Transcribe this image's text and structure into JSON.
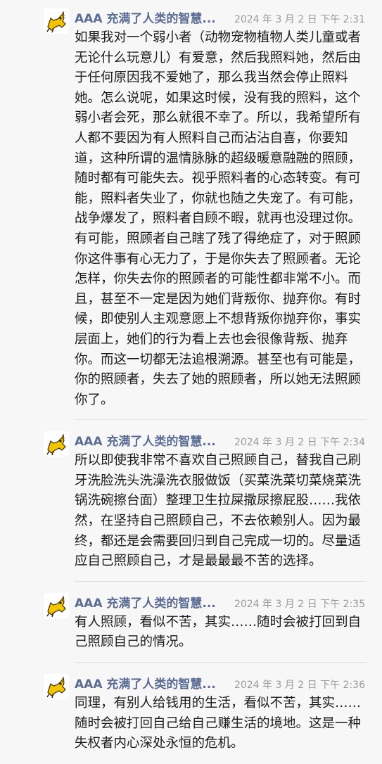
{
  "messages": [
    {
      "sender": "AAA 充满了人类的智慧...",
      "time": "2024 年 3 月 2 日 下午 2:31",
      "text": "如果我对一个弱小者（动物宠物植物人类儿童或者无论什么玩意儿）有爱意，然后我照料她，然后由于任何原因我不爱她了，那么我当然会停止照料她。怎么说呢，如果这时候，没有我的照料，这个弱小者会死，那么就很不幸了。所以，我希望所有人都不要因为有人照料自己而沾沾自喜，你要知道，这种所谓的温情脉脉的超级暖意融融的照顾，随时都有可能失去。视乎照料者的心态转变。有可能，照料者失业了，你就也随之失宠了。有可能，战争爆发了，照料者自顾不暇，就再也没理过你。有可能，照顾者自己瞎了残了得绝症了，对于照顾你这件事有心无力了，于是你失去了照顾者。无论怎样，你失去你的照顾者的可能性都非常不小。而且，甚至不一定是因为她们背叛你、抛弃你。有时候，即使别人主观意愿上不想背叛你抛弃你，事实层面上，她们的行为看上去也会很像背叛、抛弃你。而这一切都无法追根溯源。甚至也有可能是，你的照顾者，失去了她的照顾者，所以她无法照顾你了。"
    },
    {
      "sender": "AAA 充满了人类的智慧...",
      "time": "2024 年 3 月 2 日 下午 2:34",
      "text": "所以即使我非常不喜欢自己照顾自己，替我自己刷牙洗脸洗头洗澡洗衣服做饭（买菜洗菜切菜烧菜洗锅洗碗擦台面）整理卫生拉屎撒尿擦屁股……我依然，在坚持自己照顾自己，不去依赖别人。因为最终，都还是会需要回归到自己完成一切的。尽量适应自己照顾自己，才是最最最不苦的选择。"
    },
    {
      "sender": "AAA 充满了人类的智慧...",
      "time": "2024 年 3 月 2 日 下午 2:35",
      "text": "有人照顾，看似不苦，其实……随时会被打回到自己照顾自己的情况。"
    },
    {
      "sender": "AAA 充满了人类的智慧...",
      "time": "2024 年 3 月 2 日 下午 2:36",
      "text": "同理，有别人给钱用的生活，看似不苦，其实……随时会被打回自己给自己赚生活的境地。这是一种失权者内心深处永恒的危机。"
    }
  ],
  "avatar_icon": "cartoon-dog-icon"
}
